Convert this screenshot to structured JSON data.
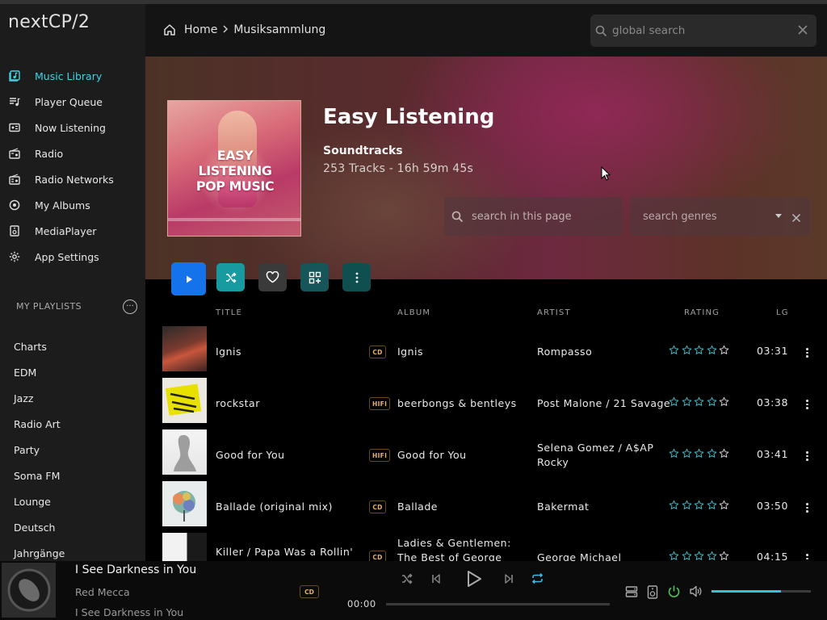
{
  "app": {
    "name": "nextCP/2"
  },
  "colors": {
    "accent": "#3fd3e4",
    "play_button": "#1473ea",
    "shuffle_button": "#179aa0",
    "badge": "#e6b06b",
    "volume": "#2ec6d6",
    "rating_star": "#3fb8c4"
  },
  "sidebar": {
    "items": [
      {
        "label": "Music Library",
        "icon": "music-library-icon",
        "active": true
      },
      {
        "label": "Player Queue",
        "icon": "queue-icon"
      },
      {
        "label": "Now Listening",
        "icon": "now-listening-icon"
      },
      {
        "label": "Radio",
        "icon": "radio-icon"
      },
      {
        "label": "Radio Networks",
        "icon": "radio-networks-icon"
      },
      {
        "label": "My Albums",
        "icon": "album-icon"
      },
      {
        "label": "MediaPlayer",
        "icon": "media-player-icon"
      },
      {
        "label": "App Settings",
        "icon": "gear-icon"
      }
    ],
    "playlists_header": "MY PLAYLISTS",
    "playlists": [
      "Charts",
      "EDM",
      "Jazz",
      "Radio Art",
      "Party",
      "Soma FM",
      "Lounge",
      "Deutsch",
      "Jahrgänge"
    ]
  },
  "header": {
    "breadcrumb": {
      "home": "Home",
      "current": "Musiksammlung"
    },
    "search_placeholder": "global search"
  },
  "hero": {
    "cover_text": "EASY LISTENING POP MUSIC",
    "title": "Easy Listening",
    "subtitle": "Soundtracks",
    "meta": "253 Tracks - 16h 59m 45s",
    "page_search_placeholder": "search in this page",
    "genre_placeholder": "search genres"
  },
  "table": {
    "headers": {
      "title": "TITLE",
      "album": "ALBUM",
      "artist": "ARTIST",
      "rating": "RATING",
      "length": "LG"
    },
    "rows": [
      {
        "title": "Ignis",
        "badge": "CD",
        "album": "Ignis",
        "artist": "Rompasso",
        "rating": 0,
        "duration": "03:31"
      },
      {
        "title": "rockstar",
        "badge": "HIFI",
        "album": "beerbongs & bentleys",
        "artist": "Post Malone / 21 Savage",
        "rating": 0,
        "duration": "03:38"
      },
      {
        "title": "Good for You",
        "badge": "HIFI",
        "album": "Good for You",
        "artist": "Selena Gomez / A$AP Rocky",
        "rating": 0,
        "duration": "03:41"
      },
      {
        "title": "Ballade (original mix)",
        "badge": "CD",
        "album": "Ballade",
        "artist": "Bakermat",
        "rating": 0,
        "duration": "03:50"
      },
      {
        "title": "Killer / Papa Was a Rollin'",
        "badge": "CD",
        "album": "Ladies & Gentlemen: The Best of George",
        "artist": "George Michael",
        "rating": 0,
        "duration": "04:15"
      }
    ]
  },
  "player": {
    "title": "I See Darkness in You",
    "artist": "Red Mecca",
    "album": "I See Darkness in You",
    "badge": "CD",
    "time": "00:00",
    "progress": 0,
    "volume": 0.7
  }
}
